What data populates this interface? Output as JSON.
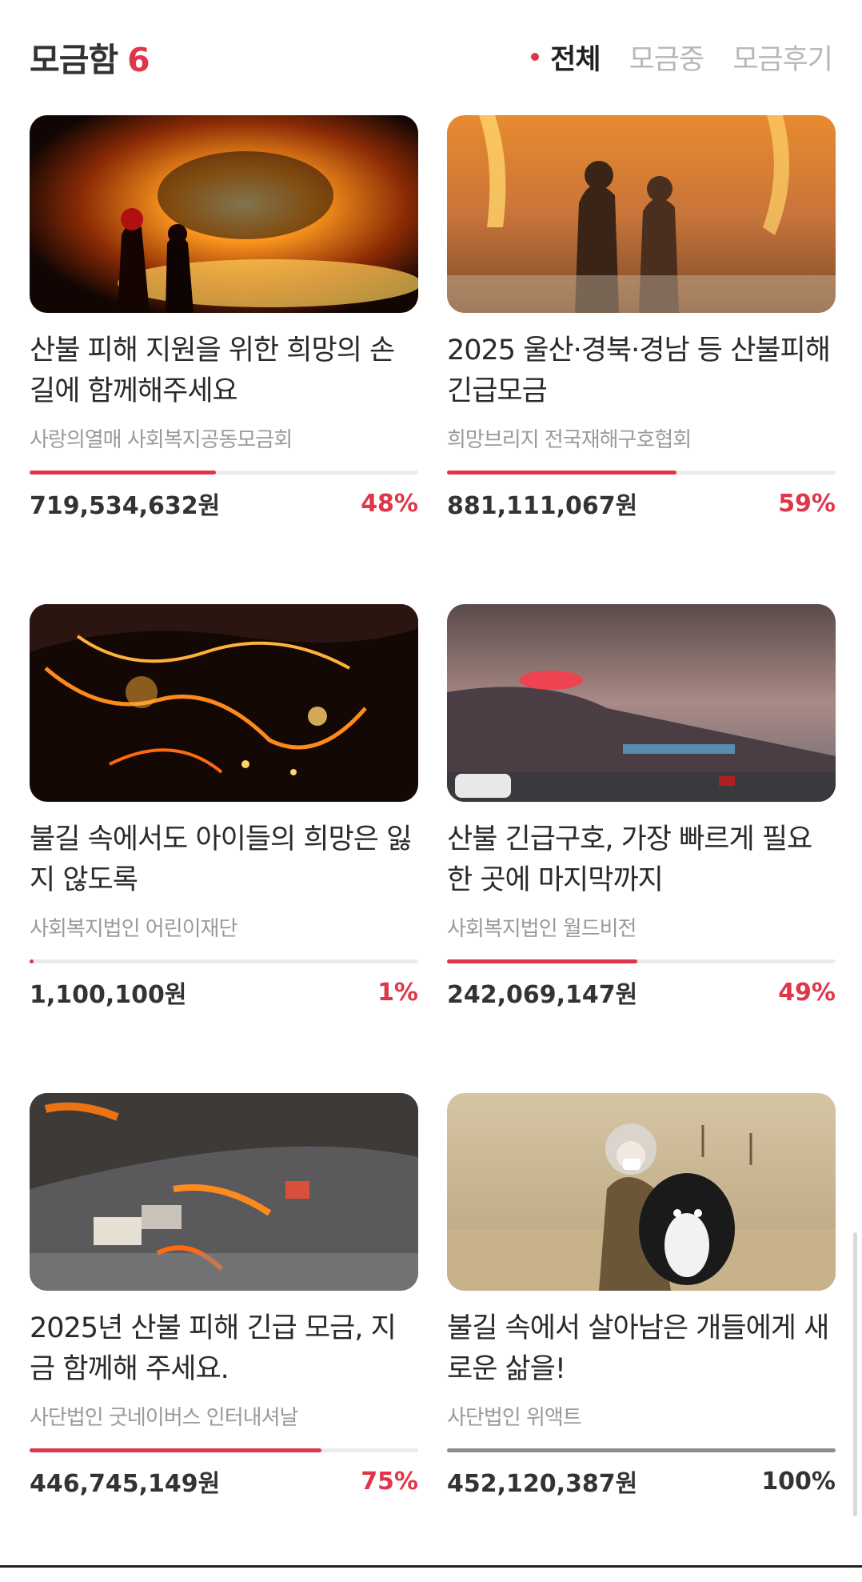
{
  "header": {
    "title": "모금함",
    "count": "6",
    "filters": [
      {
        "label": "전체",
        "active": true
      },
      {
        "label": "모금중",
        "active": false
      },
      {
        "label": "모금후기",
        "active": false
      }
    ]
  },
  "campaigns": [
    {
      "title": "산불 피해 지원을 위한 희망의 손길에 함께해주세요",
      "org": "사랑의열매 사회복지공동모금회",
      "amount": "719,534,632원",
      "percent_label": "48%",
      "progress": 0.48,
      "image": "firefighters-night-fire"
    },
    {
      "title": "2025 울산·경북·경남 등 산불피해 긴급모금",
      "org": "희망브리지 전국재해구호협회",
      "amount": "881,111,067원",
      "percent_label": "59%",
      "progress": 0.59,
      "image": "firefighters-smoke"
    },
    {
      "title": "불길 속에서도 아이들의 희망은 잃지 않도록",
      "org": "사회복지법인 어린이재단",
      "amount": "1,100,100원",
      "percent_label": "1%",
      "progress": 0.01,
      "image": "forest-fire-night"
    },
    {
      "title": "산불 긴급구호, 가장 빠르게 필요한 곳에 마지막까지",
      "org": "사회복지법인 월드비전",
      "amount": "242,069,147원",
      "percent_label": "49%",
      "progress": 0.49,
      "image": "highway-wildfire"
    },
    {
      "title": "2025년 산불 피해 긴급 모금, 지금 함께해 주세요.",
      "org": "사단법인 굿네이버스 인터내셔날",
      "amount": "446,745,149원",
      "percent_label": "75%",
      "progress": 0.75,
      "image": "village-fire-aerial"
    },
    {
      "title": "불길 속에서 살아남은 개들에게 새로운 삶을!",
      "org": "사단법인 위액트",
      "amount": "452,120,387원",
      "percent_label": "100%",
      "progress": 1.0,
      "image": "person-holding-dog"
    }
  ],
  "colors": {
    "accent": "#e0364a",
    "complete": "#8c8c8c"
  }
}
